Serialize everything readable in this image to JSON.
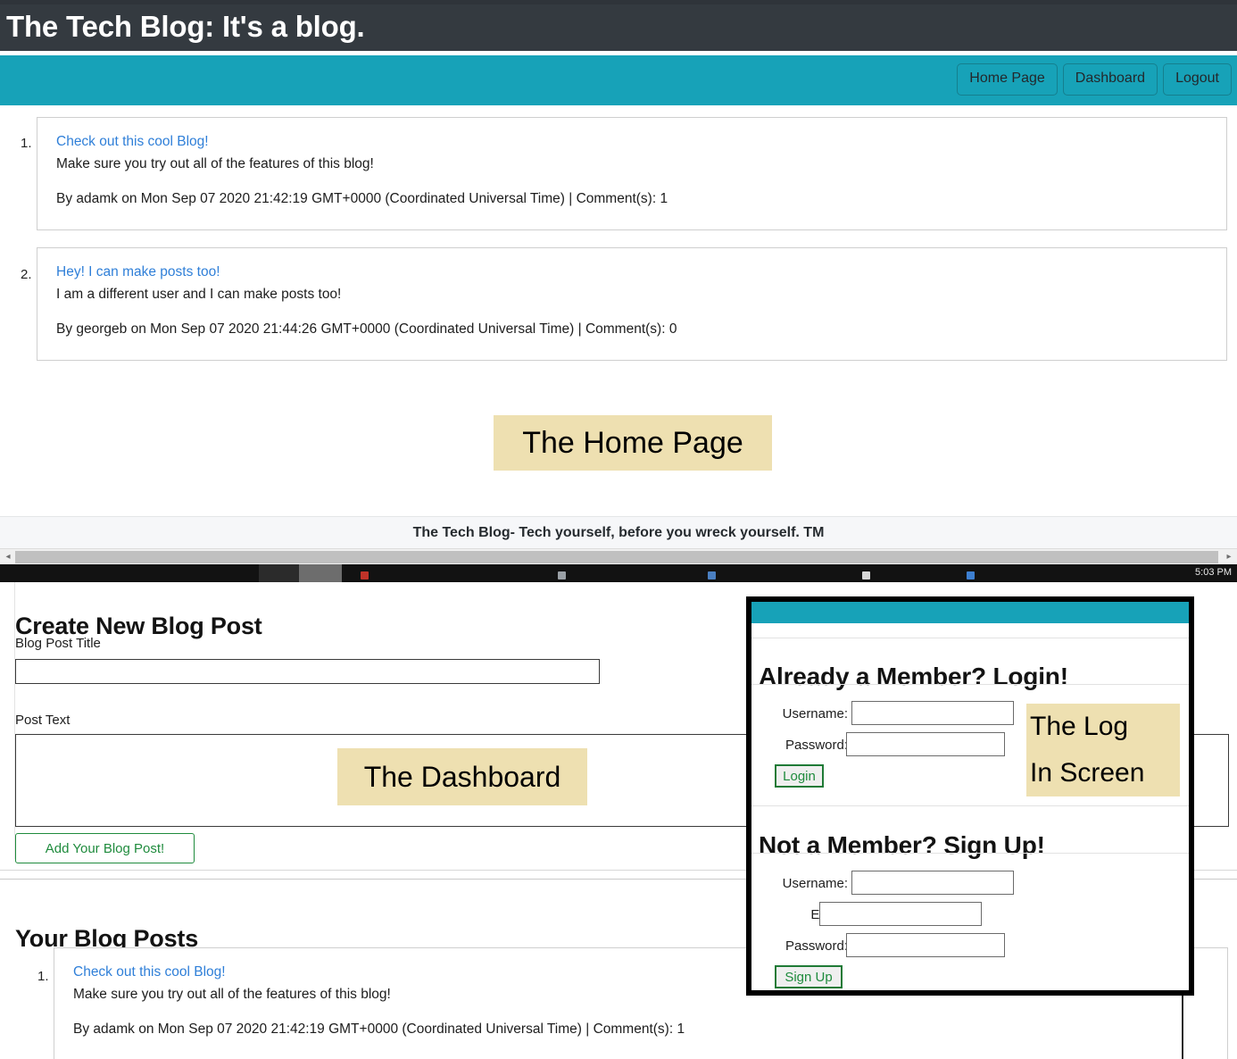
{
  "home": {
    "header_title": "The Tech Blog: It's a blog.",
    "nav": [
      {
        "label": "Home Page",
        "name": "home-page"
      },
      {
        "label": "Dashboard",
        "name": "dashboard"
      },
      {
        "label": "Logout",
        "name": "logout"
      }
    ],
    "posts": [
      {
        "index": "1.",
        "title": "Check out this cool Blog!",
        "body": "Make sure you try out all of the features of this blog!",
        "meta": "By adamk on Mon Sep 07 2020 21:42:19 GMT+0000 (Coordinated Universal Time) | Comment(s): 1"
      },
      {
        "index": "2.",
        "title": "Hey! I can make posts too!",
        "body": "I am a different user and I can make posts too!",
        "meta": "By georgeb on Mon Sep 07 2020 21:44:26 GMT+0000 (Coordinated Universal Time) | Comment(s): 0"
      }
    ],
    "annotation": "The Home Page",
    "footer": "The Tech Blog- Tech yourself, before you wreck yourself. TM",
    "scrollbar": {
      "left_arrow": "◂",
      "right_arrow": "▸"
    },
    "taskbar_clock": "5:03 PM"
  },
  "dashboard": {
    "create_heading": "Create New Blog Post",
    "title_label": "Blog Post Title",
    "title_value": "",
    "title_placeholder": "",
    "text_label": "Post Text",
    "text_value": "",
    "text_placeholder": "",
    "submit_label": "Add Your Blog Post!",
    "annotation": "The Dashboard",
    "posts_heading": "Your Blog Posts",
    "posts": [
      {
        "index": "1.",
        "title": "Check out this cool Blog!",
        "body": "Make sure you try out all of the features of this blog!",
        "meta": "By adamk on Mon Sep 07 2020 21:42:19 GMT+0000 (Coordinated Universal Time) | Comment(s): 1"
      }
    ]
  },
  "login_panel": {
    "annotation": "The Log\nIn Screen",
    "login": {
      "heading": "Already a Member? Login!",
      "username_label": "Username:",
      "username_value": "",
      "password_label": "Password:",
      "password_value": "",
      "button_label": "Login"
    },
    "signup": {
      "heading": "Not a Member? Sign Up!",
      "username_label": "Username:",
      "username_value": "",
      "email_label": "Email:",
      "email_value": "",
      "password_label": "Password:",
      "password_value": "",
      "button_label": "Sign Up"
    }
  },
  "colors": {
    "header_dark": "#343a40",
    "accent_teal": "#17a2b8",
    "link_blue": "#2f7fd8",
    "highlight_yellow": "#eee0b1",
    "button_green": "#1f8b3d"
  }
}
